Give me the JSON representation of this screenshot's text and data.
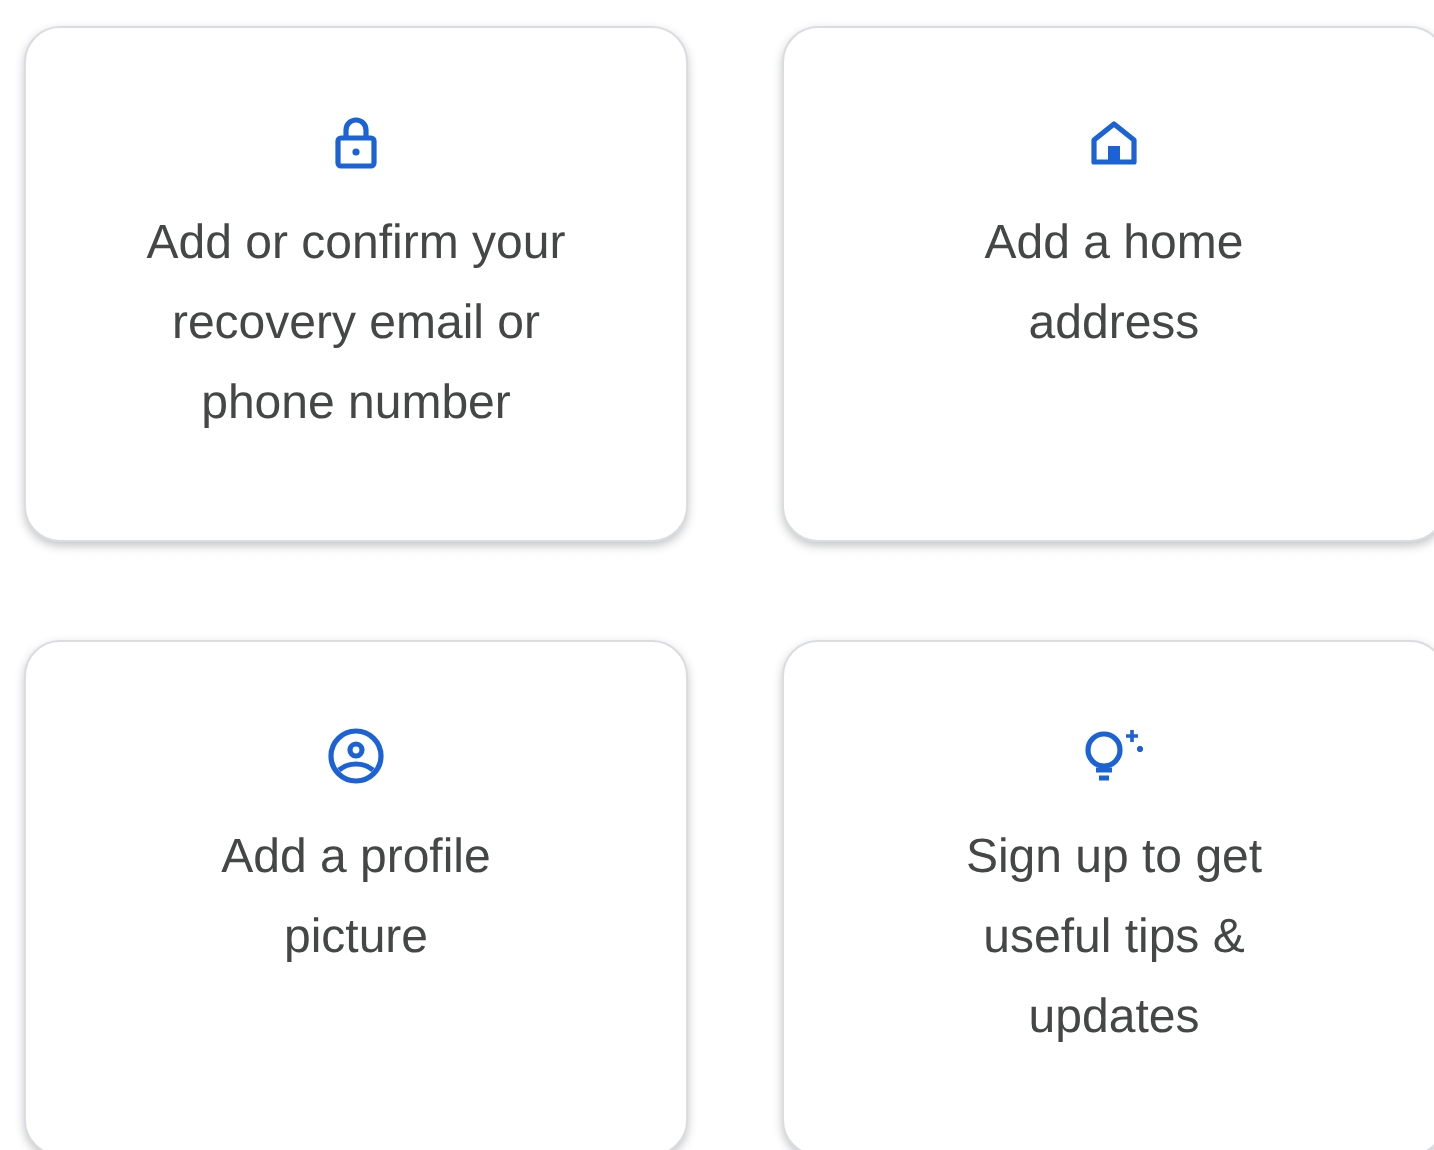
{
  "cards": [
    {
      "label": "Add or confirm your recovery email or phone number"
    },
    {
      "label": "Add a home address"
    },
    {
      "label": "Add a profile picture"
    },
    {
      "label": "Sign up to get useful tips & updates"
    }
  ]
}
